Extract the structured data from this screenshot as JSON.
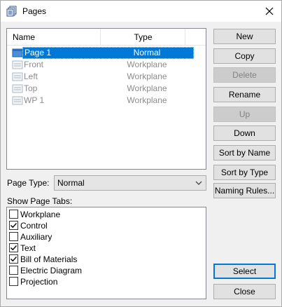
{
  "window": {
    "title": "Pages"
  },
  "list": {
    "columns": {
      "name": "Name",
      "type": "Type"
    },
    "rows": [
      {
        "name": "Page 1",
        "type": "Normal"
      },
      {
        "name": "Front",
        "type": "Workplane"
      },
      {
        "name": "Left",
        "type": "Workplane"
      },
      {
        "name": "Top",
        "type": "Workplane"
      },
      {
        "name": "WP 1",
        "type": "Workplane"
      }
    ]
  },
  "buttons": {
    "new": "New",
    "copy": "Copy",
    "delete": "Delete",
    "rename": "Rename",
    "up": "Up",
    "down": "Down",
    "sort_by_name": "Sort by Name",
    "sort_by_type": "Sort by Type",
    "naming_rules": "Naming Rules...",
    "select": "Select",
    "close": "Close"
  },
  "page_type": {
    "label": "Page Type:",
    "value": "Normal"
  },
  "page_tabs": {
    "label": "Show Page Tabs:",
    "items": [
      {
        "label": "Workplane",
        "checked": false
      },
      {
        "label": "Control",
        "checked": true
      },
      {
        "label": "Auxiliary",
        "checked": false
      },
      {
        "label": "Text",
        "checked": true
      },
      {
        "label": "Bill of Materials",
        "checked": true
      },
      {
        "label": "Electric Diagram",
        "checked": false
      },
      {
        "label": "Projection",
        "checked": false
      }
    ]
  },
  "icons": {
    "title": "pages-icon",
    "close": "close-icon",
    "page": "page-icon",
    "dropdown": "chevron-down-icon",
    "check": "checkmark-icon"
  },
  "colors": {
    "selection": "#0078d7",
    "default_button_border": "#0078d7",
    "disabled_text": "#8c8c8c"
  }
}
